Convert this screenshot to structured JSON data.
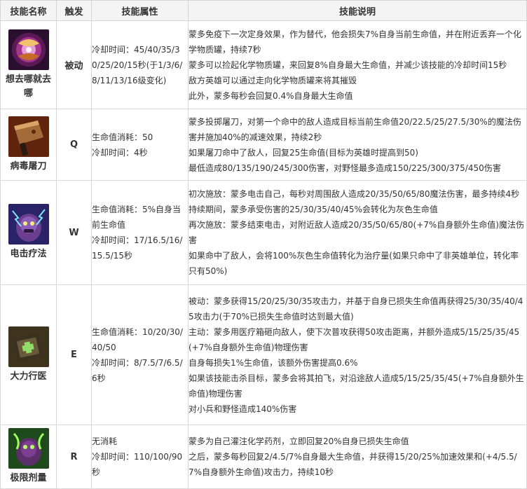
{
  "headers": {
    "name": "技能名称",
    "trigger": "触发",
    "attributes": "技能属性",
    "description": "技能说明"
  },
  "skills": [
    {
      "name": "想去哪就去哪",
      "icon": "purple-orb-icon",
      "trigger": "被动",
      "attributes": [
        "冷却时间：45/40/35/30/25/20/15秒(于1/3/6/8/11/13/16级变化)"
      ],
      "description": [
        "蒙多免疫下一次定身效果，作为替代，他会损失7%自身当前生命值，并在附近丢弃一个化学物质罐，持续7秒",
        "蒙多可以捡起化学物质罐，来回复8%自身最大生命值，并减少该技能的冷却时间15秒",
        "敌方英雄可以通过走向化学物质罐来将其摧毁",
        "此外，蒙多每秒会回复0.4%自身最大生命值"
      ]
    },
    {
      "name": "病毒屠刀",
      "icon": "cleaver-icon",
      "trigger": "Q",
      "attributes": [
        "生命值消耗：50",
        "冷却时间：4秒"
      ],
      "description": [
        "蒙多投掷屠刀，对第一个命中的敌人造成目标当前生命值20/22.5/25/27.5/30%的魔法伤害并施加40%的减速效果，持续2秒",
        "如果屠刀命中了敌人，回复25生命值(目标为英雄时提高到50)",
        "最低造成80/135/190/245/300伤害，对野怪最多造成150/225/300/375/450伤害"
      ]
    },
    {
      "name": "电击疗法",
      "icon": "electric-shock-icon",
      "trigger": "W",
      "attributes": [
        "生命值消耗：5%自身当前生命值",
        "冷却时间：17/16.5/16/15.5/15秒"
      ],
      "description": [
        "初次施放：蒙多电击自己，每秒对周围敌人造成20/35/50/65/80魔法伤害，最多持续4秒",
        "持续期间，蒙多承受伤害的25/30/35/40/45%会转化为灰色生命值",
        "再次施放：蒙多结束电击，对附近敌人造成20/35/50/65/80(+7%自身额外生命值)魔法伤害",
        "如果命中了敌人，会将100%灰色生命值转化为治疗量(如果只命中了非英雄单位，转化率只有50%)"
      ]
    },
    {
      "name": "大力行医",
      "icon": "medkit-icon",
      "trigger": "E",
      "attributes": [
        "生命值消耗：10/20/30/40/50",
        "冷却时间：8/7.5/7/6.5/6秒"
      ],
      "description": [
        "被动：蒙多获得15/20/25/30/35攻击力，并基于自身已损失生命值再获得25/30/35/40/45攻击力(于70%已损失生命值时达到最大值)",
        "主动：蒙多用医疗箱砸向敌人，使下次普攻获得50攻击距离，并额外造成5/15/25/35/45(+7%自身额外生命值)物理伤害",
        "自身每损失1%生命值，该额外伤害提高0.6%",
        "如果该技能击杀目标，蒙多会将其拍飞，对沿途敌人造成5/15/25/35/45(+7%自身额外生命值)物理伤害",
        "对小兵和野怪造成140%伤害"
      ]
    },
    {
      "name": "极限剂量",
      "icon": "syringe-dose-icon",
      "trigger": "R",
      "attributes": [
        "无消耗",
        "冷却时间：110/100/90秒"
      ],
      "description": [
        "蒙多为自己灌注化学药剂，立即回复20%自身已损失生命值",
        "之后，蒙多每秒回复2/4.5/7%自身最大生命值，并获得15/20/25%加速效果和(+4/5.5/7%自身额外生命值)攻击力，持续10秒"
      ]
    }
  ],
  "colors": {
    "header_bg": "#f4f4f4",
    "border": "#d6d6d6",
    "text": "#333333"
  }
}
